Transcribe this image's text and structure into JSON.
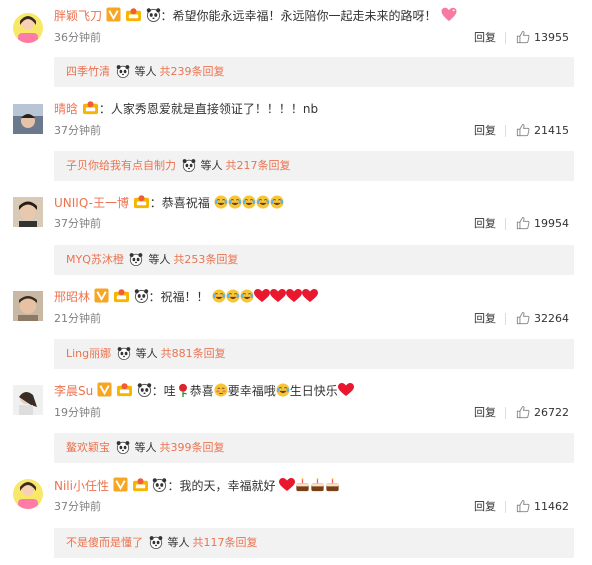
{
  "comments": [
    {
      "username": "胖颖飞刀",
      "badges": [
        "v-badge",
        "fans-badge",
        "panda-emoji"
      ],
      "text": "希望你能永远幸福！永远陪你一起走未来的路呀！",
      "emojis": [
        "heart-sparkle"
      ],
      "time": "36分钟前",
      "reply": "回复",
      "likes": "13955",
      "sub": {
        "user": "四季竹清",
        "suffix": "等人",
        "count": "共239条回复"
      }
    },
    {
      "username": "晴晗",
      "badges": [
        "fans-badge"
      ],
      "text": "人家秀恩爱就是直接领证了！！！！nb",
      "emojis": [],
      "time": "37分钟前",
      "reply": "回复",
      "likes": "21415",
      "sub": {
        "user": "子贝你给我有点自制力",
        "suffix": "等人",
        "count": "共217条回复"
      }
    },
    {
      "username": "UNIIQ-王一博",
      "badges": [
        "fans-badge"
      ],
      "text": "恭喜祝福",
      "emojis": [
        "laugh-cry",
        "laugh-cry",
        "laugh-cry",
        "laugh-cry",
        "laugh-cry"
      ],
      "time": "37分钟前",
      "reply": "回复",
      "likes": "19954",
      "sub": {
        "user": "MYQ苏沐橙",
        "suffix": "等人",
        "count": "共253条回复"
      }
    },
    {
      "username": "邢昭林",
      "badges": [
        "v-badge",
        "fans-badge",
        "panda-emoji"
      ],
      "text": "祝福！！",
      "emojis": [
        "laugh-cry",
        "laugh-cry",
        "laugh-cry",
        "red-heart",
        "red-heart",
        "red-heart",
        "red-heart"
      ],
      "time": "21分钟前",
      "reply": "回复",
      "likes": "32264",
      "sub": {
        "user": "Ling丽娜",
        "suffix": "等人",
        "count": "共881条回复"
      }
    },
    {
      "username": "李晨Su",
      "badges": [
        "v-badge",
        "fans-badge",
        "panda-emoji"
      ],
      "text_parts": [
        "哇",
        "恭喜",
        "要幸福哦",
        "生日快乐"
      ],
      "emojis": [
        "rose",
        "blush",
        "laugh-cry",
        "red-heart"
      ],
      "time": "19分钟前",
      "reply": "回复",
      "likes": "26722",
      "sub": {
        "user": "鳌欢颖宝",
        "suffix": "等人",
        "count": "共399条回复"
      }
    },
    {
      "username": "Nili小任性",
      "badges": [
        "v-badge",
        "fans-badge",
        "panda-emoji"
      ],
      "text": "我的天，幸福就好",
      "emojis": [
        "red-heart",
        "cake",
        "cake",
        "cake"
      ],
      "time": "37分钟前",
      "reply": "回复",
      "likes": "11462",
      "sub": {
        "user": "不是傻而是懂了",
        "suffix": "等人",
        "count": "共117条回复"
      }
    }
  ],
  "colors": {
    "username": "#eb7350",
    "text": "#333333",
    "time": "#808080",
    "sub_bg": "#f2f2f2"
  }
}
